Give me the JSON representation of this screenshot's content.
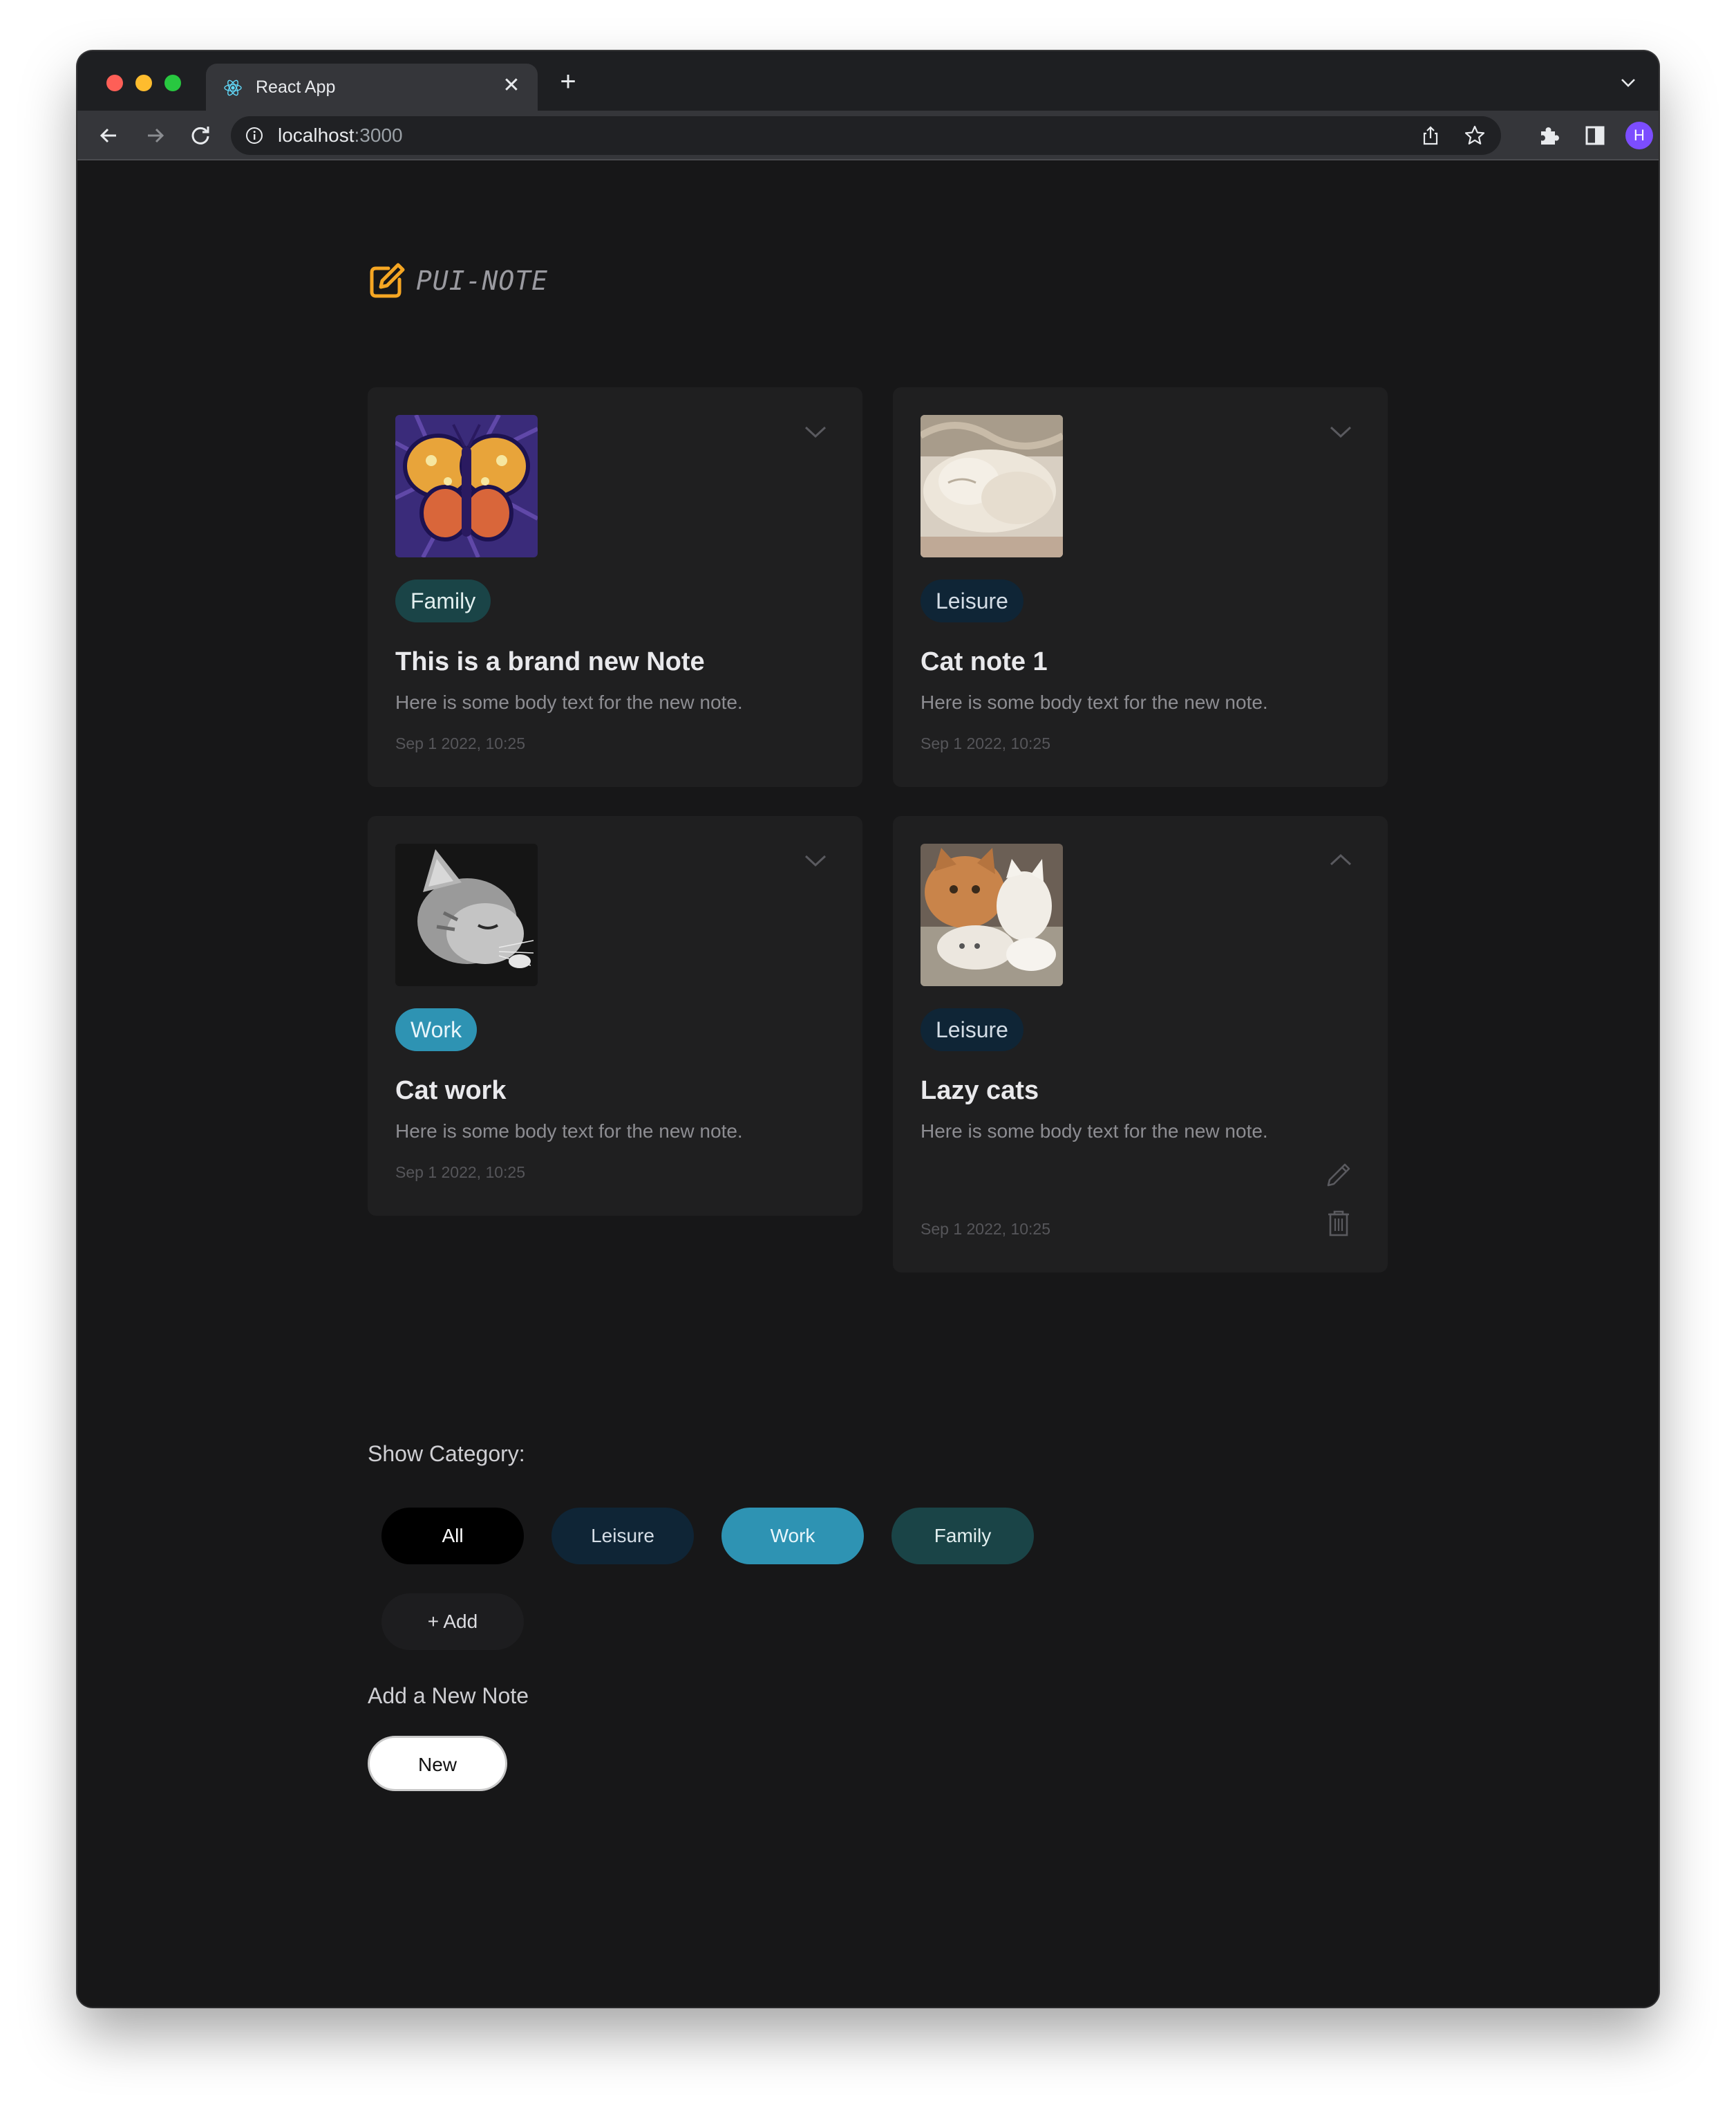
{
  "browser": {
    "tab_title": "React App",
    "url_host": "localhost",
    "url_port": ":3000",
    "profile_initial": "H"
  },
  "app": {
    "name": "PUI-NOTE",
    "accent_color": "#f5a623"
  },
  "notes": [
    {
      "image": "butterfly-image",
      "category": "Family",
      "title": "This is a brand new Note",
      "body": "Here is some body text for the new note.",
      "date": "Sep 1 2022, 10:25",
      "expanded": false
    },
    {
      "image": "sleeping-cat-image",
      "category": "Leisure",
      "title": "Cat note 1",
      "body": "Here is some body text for the new note.",
      "date": "Sep 1 2022, 10:25",
      "expanded": false
    },
    {
      "image": "kitten-bw-image",
      "category": "Work",
      "title": "Cat work",
      "body": "Here is some body text for the new note.",
      "date": "Sep 1 2022, 10:25",
      "expanded": false
    },
    {
      "image": "cats-group-image",
      "category": "Leisure",
      "title": "Lazy cats",
      "body": "Here is some body text for the new note.",
      "date": "Sep 1 2022, 10:25",
      "expanded": true
    }
  ],
  "category_colors": {
    "All": {
      "bg": "#000000",
      "fg": "#ffffff"
    },
    "Leisure": {
      "bg": "#0f2536",
      "fg": "#d4dde6"
    },
    "Work": {
      "bg": "#2e93b3",
      "fg": "#e8f6fb"
    },
    "Family": {
      "bg": "#1a4447",
      "fg": "#e2efef"
    }
  },
  "filter": {
    "label": "Show Category:",
    "options": [
      "All",
      "Leisure",
      "Work",
      "Family"
    ],
    "add_label": "+ Add"
  },
  "add_note": {
    "label": "Add a New Note",
    "button": "New"
  }
}
